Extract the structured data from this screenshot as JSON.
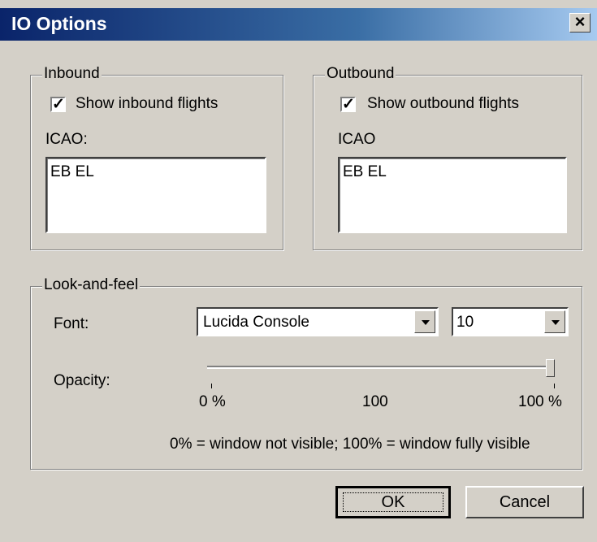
{
  "window": {
    "title": "IO Options"
  },
  "inbound": {
    "legend": "Inbound",
    "checkbox_label": "Show inbound flights",
    "checked": true,
    "icao_label": "ICAO:",
    "icao_value": "EB EL"
  },
  "outbound": {
    "legend": "Outbound",
    "checkbox_label": "Show outbound flights",
    "checked": true,
    "icao_label": "ICAO",
    "icao_value": "EB EL"
  },
  "look_and_feel": {
    "legend": "Look-and-feel",
    "font_label": "Font:",
    "font_value": "Lucida Console",
    "size_value": "10",
    "opacity_label": "Opacity:",
    "opacity_percent": 100,
    "tick_labels": [
      "0 %",
      "100",
      "100 %"
    ],
    "note": "0% = window not visible; 100% = window fully visible"
  },
  "buttons": {
    "ok": "OK",
    "cancel": "Cancel"
  }
}
